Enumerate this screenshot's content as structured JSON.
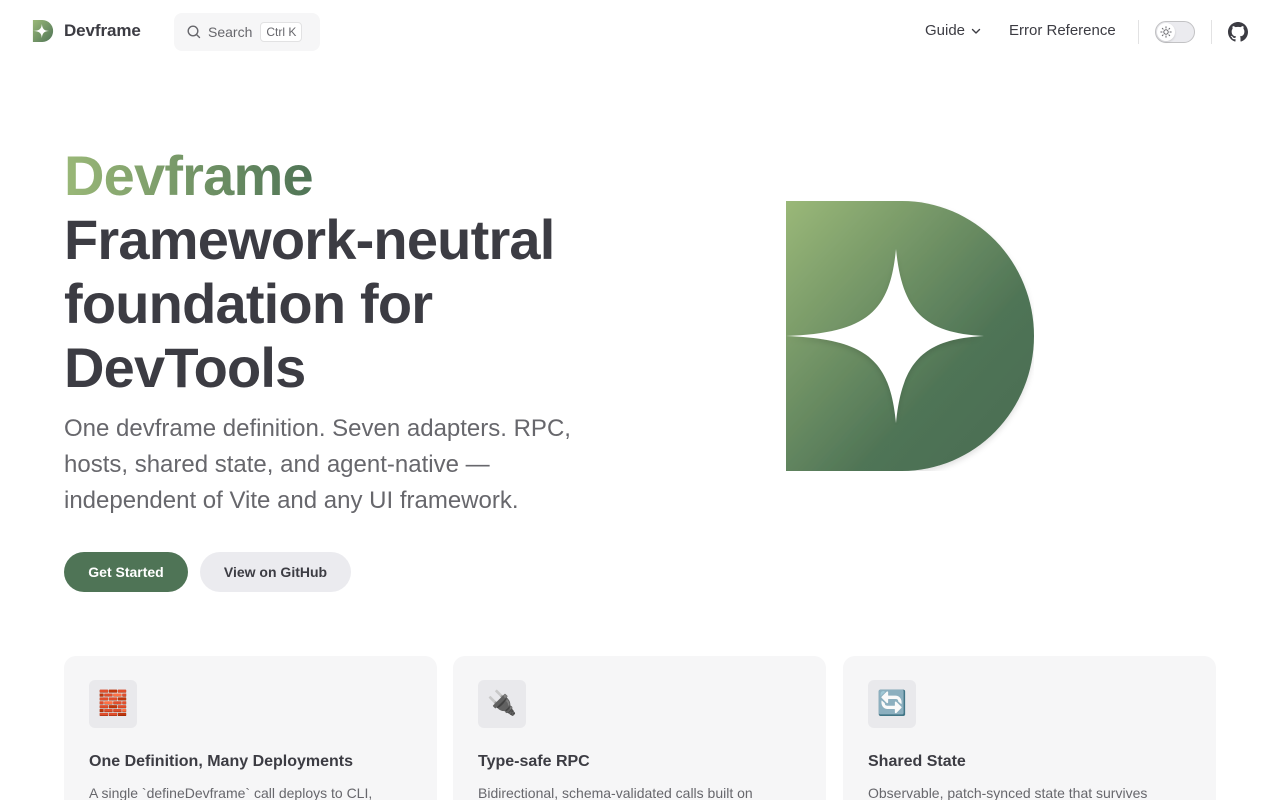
{
  "nav": {
    "brand": "Devframe",
    "search_label": "Search",
    "search_kbd": "Ctrl K",
    "guide": "Guide",
    "error_reference": "Error Reference"
  },
  "hero": {
    "name": "Devframe",
    "text": "Framework-neutral foundation for DevTools",
    "tagline": "One devframe definition. Seven adapters. RPC, hosts, shared state, and agent-native — independent of Vite and any UI framework.",
    "actions": {
      "primary": "Get Started",
      "secondary": "View on GitHub"
    }
  },
  "features": [
    {
      "icon": "🧱",
      "icon_name": "brick-icon",
      "title": "One Definition, Many Deployments",
      "details": "A single `defineDevframe` call deploys to CLI,"
    },
    {
      "icon": "🔌",
      "icon_name": "plug-icon",
      "title": "Type-safe RPC",
      "details": "Bidirectional, schema-validated calls built on"
    },
    {
      "icon": "🔄",
      "icon_name": "refresh-icon",
      "title": "Shared State",
      "details": "Observable, patch-synced state that survives"
    }
  ],
  "colors": {
    "brand": "#4f7456",
    "brand_light": "#9ab878",
    "text": "#3c3c43",
    "muted": "#67676c",
    "surface": "#f6f6f7"
  }
}
